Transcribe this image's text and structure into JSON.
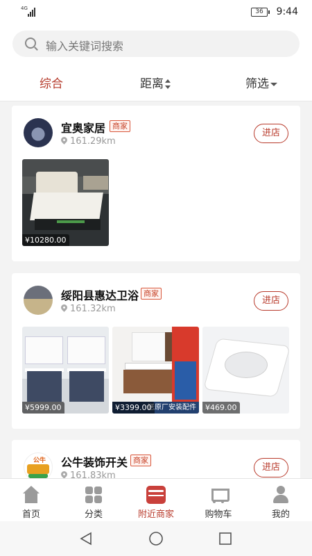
{
  "status_bar": {
    "network": "4G",
    "battery": "36",
    "time": "9:44"
  },
  "search": {
    "placeholder": "输入关键词搜索"
  },
  "filters": {
    "all": "综合",
    "distance": "距离",
    "filter": "筛选"
  },
  "shops": [
    {
      "name": "宜奥家居",
      "tag": "商家",
      "distance": "161.29km",
      "enter": "进店",
      "products": [
        {
          "price": "¥10280.00"
        }
      ]
    },
    {
      "name": "绥阳县惠达卫浴",
      "tag": "商家",
      "distance": "161.32km",
      "enter": "进店",
      "products": [
        {
          "price": "¥5999.00"
        },
        {
          "price": "¥3399.00",
          "note": "送原厂安装配件"
        },
        {
          "price": "¥469.00"
        }
      ]
    },
    {
      "name": "公牛装饰开关",
      "tag": "商家",
      "distance": "161.83km",
      "enter": "进店",
      "avatar_text": "公牛"
    }
  ],
  "tabbar": [
    {
      "label": "首页",
      "icon": "home-icon",
      "active": false
    },
    {
      "label": "分类",
      "icon": "category-icon",
      "active": false
    },
    {
      "label": "附近商家",
      "icon": "nearby-shop-icon",
      "active": true
    },
    {
      "label": "购物车",
      "icon": "cart-icon",
      "active": false
    },
    {
      "label": "我的",
      "icon": "profile-icon",
      "active": false
    }
  ],
  "colors": {
    "accent": "#b83a2b",
    "tag": "#c7442a",
    "background": "#f3f3f3"
  }
}
